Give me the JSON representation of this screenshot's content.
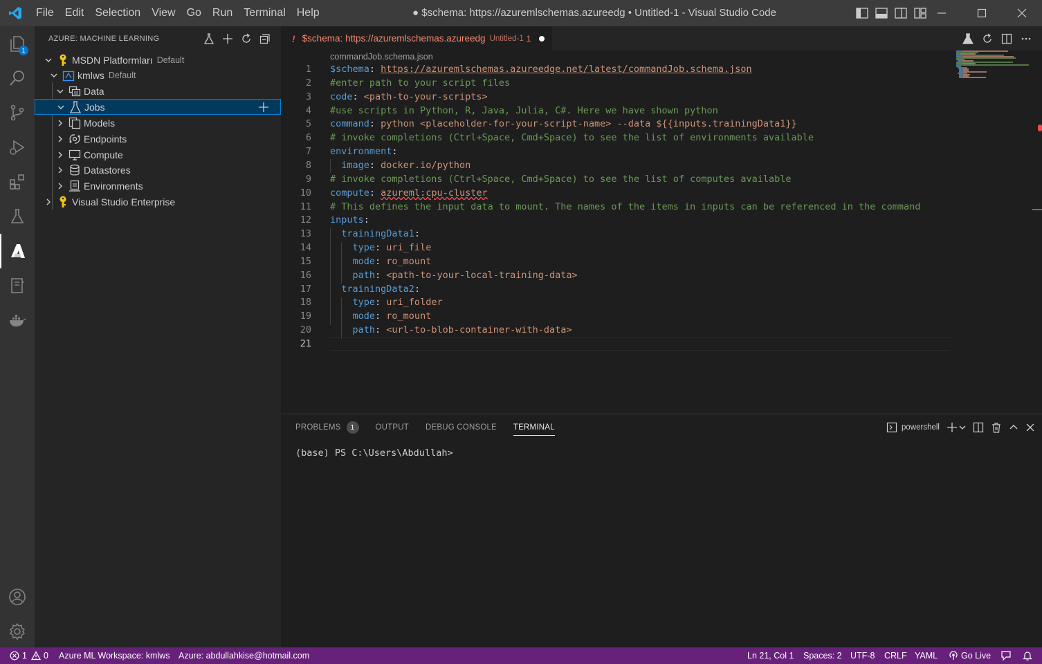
{
  "window": {
    "title": "● $schema: https://azuremlschemas.azureedg • Untitled-1 - Visual Studio Code",
    "menu": [
      "File",
      "Edit",
      "Selection",
      "View",
      "Go",
      "Run",
      "Terminal",
      "Help"
    ]
  },
  "activity_bar": {
    "items": [
      "explorer-icon",
      "search-icon",
      "source-control-icon",
      "run-debug-icon",
      "extensions-icon",
      "testing-flask-icon",
      "azure-icon",
      "notebook-icon",
      "docker-icon"
    ],
    "explorer_badge": "1",
    "active": "azure-icon",
    "bottom": [
      "account-icon",
      "settings-gear-icon"
    ]
  },
  "sidebar": {
    "header": "AZURE: MACHINE LEARNING",
    "tree": [
      {
        "label": "MSDN Platformları",
        "desc": "Default",
        "icon": "key-icon"
      },
      {
        "label": "kmlws",
        "desc": "Default",
        "icon": "workspace-icon"
      },
      {
        "label": "Data",
        "icon": "data-icon"
      },
      {
        "label": "Jobs",
        "icon": "flask-icon",
        "selected": true
      },
      {
        "label": "Models",
        "icon": "models-icon"
      },
      {
        "label": "Endpoints",
        "icon": "endpoints-icon"
      },
      {
        "label": "Compute",
        "icon": "compute-icon"
      },
      {
        "label": "Datastores",
        "icon": "database-icon"
      },
      {
        "label": "Environments",
        "icon": "environment-icon"
      },
      {
        "label": "Visual Studio Enterprise",
        "icon": "key-icon"
      }
    ]
  },
  "editor": {
    "tab": {
      "warning": "!",
      "name": "$schema: https://azuremlschemas.azureedg",
      "desc": "Untitled-1",
      "problems": "1"
    },
    "breadcrumb": "commandJob.schema.json",
    "current_line": 21,
    "lines": [
      {
        "n": "1",
        "parts": [
          [
            "k",
            "$schema"
          ],
          [
            "p",
            ": "
          ],
          [
            "u",
            "https://azuremlschemas.azureedge.net/latest/commandJob.schema.json"
          ]
        ]
      },
      {
        "n": "2",
        "parts": [
          [
            "c",
            "#enter path to your script files"
          ]
        ]
      },
      {
        "n": "3",
        "parts": [
          [
            "k",
            "code"
          ],
          [
            "p",
            ": "
          ],
          [
            "v",
            "<path-to-your-scripts>"
          ]
        ]
      },
      {
        "n": "4",
        "parts": [
          [
            "c",
            "#use scripts in Python, R, Java, Julia, C#. Here we have shown python"
          ]
        ]
      },
      {
        "n": "5",
        "parts": [
          [
            "k",
            "command"
          ],
          [
            "p",
            ": "
          ],
          [
            "v",
            "python <placeholder-for-your-script-name> --data ${{inputs.trainingData1}}"
          ]
        ]
      },
      {
        "n": "6",
        "parts": [
          [
            "c",
            "# invoke completions (Ctrl+Space, Cmd+Space) to see the list of environments available"
          ]
        ]
      },
      {
        "n": "7",
        "parts": [
          [
            "k",
            "environment"
          ],
          [
            "p",
            ":"
          ]
        ]
      },
      {
        "n": "8",
        "parts": [
          [
            "p",
            "  "
          ],
          [
            "k",
            "image"
          ],
          [
            "p",
            ": "
          ],
          [
            "v",
            "docker.io/python"
          ]
        ]
      },
      {
        "n": "9",
        "parts": [
          [
            "c",
            "# invoke completions (Ctrl+Space, Cmd+Space) to see the list of computes available"
          ]
        ]
      },
      {
        "n": "10",
        "parts": [
          [
            "k",
            "compute"
          ],
          [
            "p",
            ": "
          ],
          [
            "sq",
            "azureml:cpu-cluster"
          ]
        ]
      },
      {
        "n": "11",
        "parts": [
          [
            "c",
            "# This defines the input data to mount. The names of the items in inputs can be referenced in the command"
          ]
        ]
      },
      {
        "n": "12",
        "parts": [
          [
            "k",
            "inputs"
          ],
          [
            "p",
            ":"
          ]
        ]
      },
      {
        "n": "13",
        "parts": [
          [
            "p",
            "  "
          ],
          [
            "k",
            "trainingData1"
          ],
          [
            "p",
            ":"
          ]
        ]
      },
      {
        "n": "14",
        "parts": [
          [
            "p",
            "    "
          ],
          [
            "k",
            "type"
          ],
          [
            "p",
            ": "
          ],
          [
            "v",
            "uri_file"
          ]
        ]
      },
      {
        "n": "15",
        "parts": [
          [
            "p",
            "    "
          ],
          [
            "k",
            "mode"
          ],
          [
            "p",
            ": "
          ],
          [
            "v",
            "ro_mount"
          ]
        ]
      },
      {
        "n": "16",
        "parts": [
          [
            "p",
            "    "
          ],
          [
            "k",
            "path"
          ],
          [
            "p",
            ": "
          ],
          [
            "v",
            "<path-to-your-local-training-data>"
          ]
        ]
      },
      {
        "n": "17",
        "parts": [
          [
            "p",
            "  "
          ],
          [
            "k",
            "trainingData2"
          ],
          [
            "p",
            ":"
          ]
        ]
      },
      {
        "n": "18",
        "parts": [
          [
            "p",
            "    "
          ],
          [
            "k",
            "type"
          ],
          [
            "p",
            ": "
          ],
          [
            "v",
            "uri_folder"
          ]
        ]
      },
      {
        "n": "19",
        "parts": [
          [
            "p",
            "    "
          ],
          [
            "k",
            "mode"
          ],
          [
            "p",
            ": "
          ],
          [
            "v",
            "ro_mount"
          ]
        ]
      },
      {
        "n": "20",
        "parts": [
          [
            "p",
            "    "
          ],
          [
            "k",
            "path"
          ],
          [
            "p",
            ": "
          ],
          [
            "v",
            "<url-to-blob-container-with-data>"
          ]
        ]
      },
      {
        "n": "21",
        "parts": []
      }
    ]
  },
  "panel": {
    "tabs": [
      {
        "label": "PROBLEMS",
        "badge": "1"
      },
      {
        "label": "OUTPUT"
      },
      {
        "label": "DEBUG CONSOLE"
      },
      {
        "label": "TERMINAL",
        "active": true
      }
    ],
    "shell": "powershell",
    "terminal_text": "(base) PS C:\\Users\\Abdullah>"
  },
  "status_bar": {
    "errors": "1",
    "warnings": "0",
    "workspace": "Azure ML Workspace: kmlws",
    "account": "Azure: abdullahkise@hotmail.com",
    "position": "Ln 21, Col 1",
    "spaces": "Spaces: 2",
    "encoding": "UTF-8",
    "eol": "CRLF",
    "language": "YAML",
    "live": "Go Live"
  },
  "colors": {
    "status_bar": "#68217a",
    "selection": "#04395e",
    "accent": "#007fd4"
  }
}
